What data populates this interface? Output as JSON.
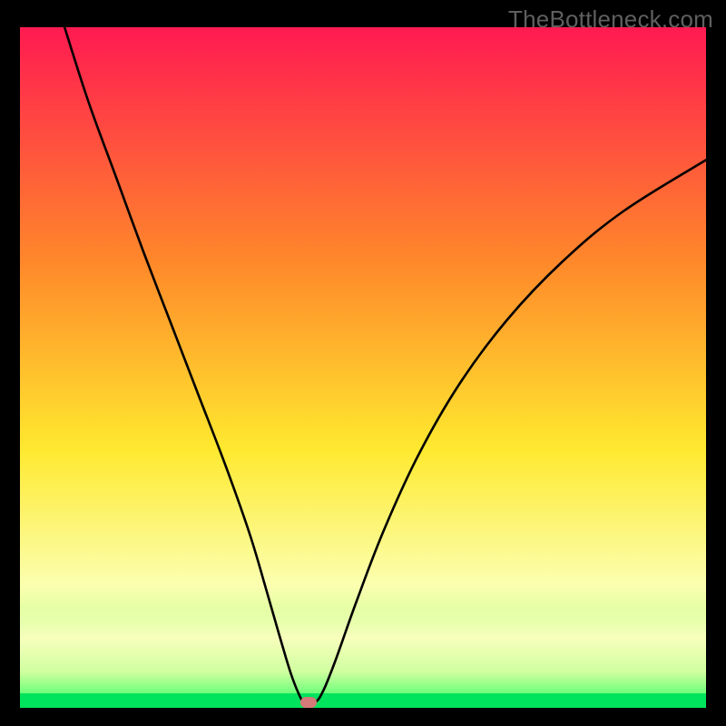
{
  "watermark": "TheBottleneck.com",
  "chart_data": {
    "type": "line",
    "title": "",
    "xlabel": "",
    "ylabel": "",
    "xlim": [
      0,
      100
    ],
    "ylim": [
      0,
      100
    ],
    "grid": false,
    "legend": false,
    "gradient_stops": [
      {
        "offset": 0,
        "color": "#ff1a51"
      },
      {
        "offset": 35,
        "color": "#ff8a2a"
      },
      {
        "offset": 62,
        "color": "#ffe92f"
      },
      {
        "offset": 82,
        "color": "#fbffb0"
      },
      {
        "offset": 93,
        "color": "#b4ff8c"
      },
      {
        "offset": 100,
        "color": "#00e35c"
      }
    ],
    "series": [
      {
        "name": "bottleneck-curve",
        "stroke": "#000000",
        "stroke_width": 2.6,
        "x": [
          6.5,
          10,
          14,
          18,
          22,
          26,
          30,
          33.5,
          36,
          38,
          39.5,
          40.8,
          41.5,
          43.0,
          44.2,
          46,
          49,
          53,
          58,
          64,
          71,
          79,
          88,
          100
        ],
        "y": [
          100,
          89,
          78,
          67,
          56.5,
          46,
          35.5,
          25.5,
          17,
          10,
          5,
          1.7,
          0.8,
          0.8,
          2.5,
          7,
          15.5,
          26,
          37,
          47.5,
          57,
          65.5,
          73,
          80.5
        ]
      }
    ],
    "marker": {
      "x": 42.0,
      "y": 0.8,
      "color": "#d47a78"
    }
  }
}
